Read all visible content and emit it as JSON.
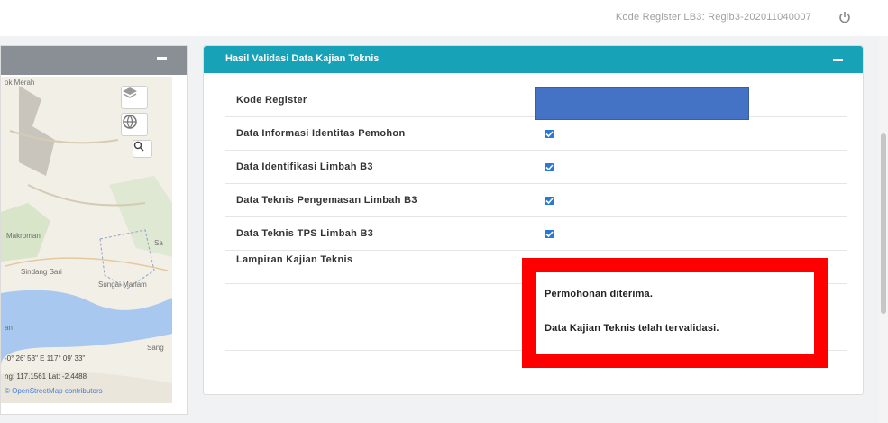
{
  "header": {
    "register_text": "Kode Register LB3: Reglb3-202011040007",
    "power_icon": "power-icon"
  },
  "map_panel": {
    "collapse_icon": "minus-icon",
    "controls": [
      "layers-icon",
      "world-icon",
      "search-icon"
    ],
    "labels": {
      "top_left": "ok Merah",
      "mid_left": "Makroman",
      "mid_right": "Sa",
      "lower_1": "Sindang Sari",
      "lower_2": "Sungai Mariam",
      "left_edge": "an",
      "bottom_right": "Sang"
    },
    "coords_1": "-0° 26' 53\" E 117° 09' 33\"",
    "coords_2": "ng: 117.1561 Lat: -2.4488",
    "attribution": "© OpenStreetMap contributors"
  },
  "validation": {
    "title": "Hasil Validasi Data Kajian Teknis",
    "collapse_icon": "minus-icon",
    "rows": [
      {
        "label": "Kode Register"
      },
      {
        "label": "Data Informasi Identitas Pemohon",
        "checked": true
      },
      {
        "label": "Data Identifikasi Limbah B3",
        "checked": true
      },
      {
        "label": "Data Teknis Pengemasan Limbah B3",
        "checked": true
      },
      {
        "label": "Data Teknis TPS Limbah B3",
        "checked": true
      },
      {
        "label": "Lampiran Kajian Teknis"
      }
    ],
    "notice": {
      "line1": "Permohonan diterima.",
      "line2": "Data Kajian Teknis telah tervalidasi."
    }
  },
  "colors": {
    "header_accent": "#17a2b8",
    "checkbox": "#2878d6",
    "highlight_border": "#ff0000",
    "redacted_field": "#4472c4"
  }
}
